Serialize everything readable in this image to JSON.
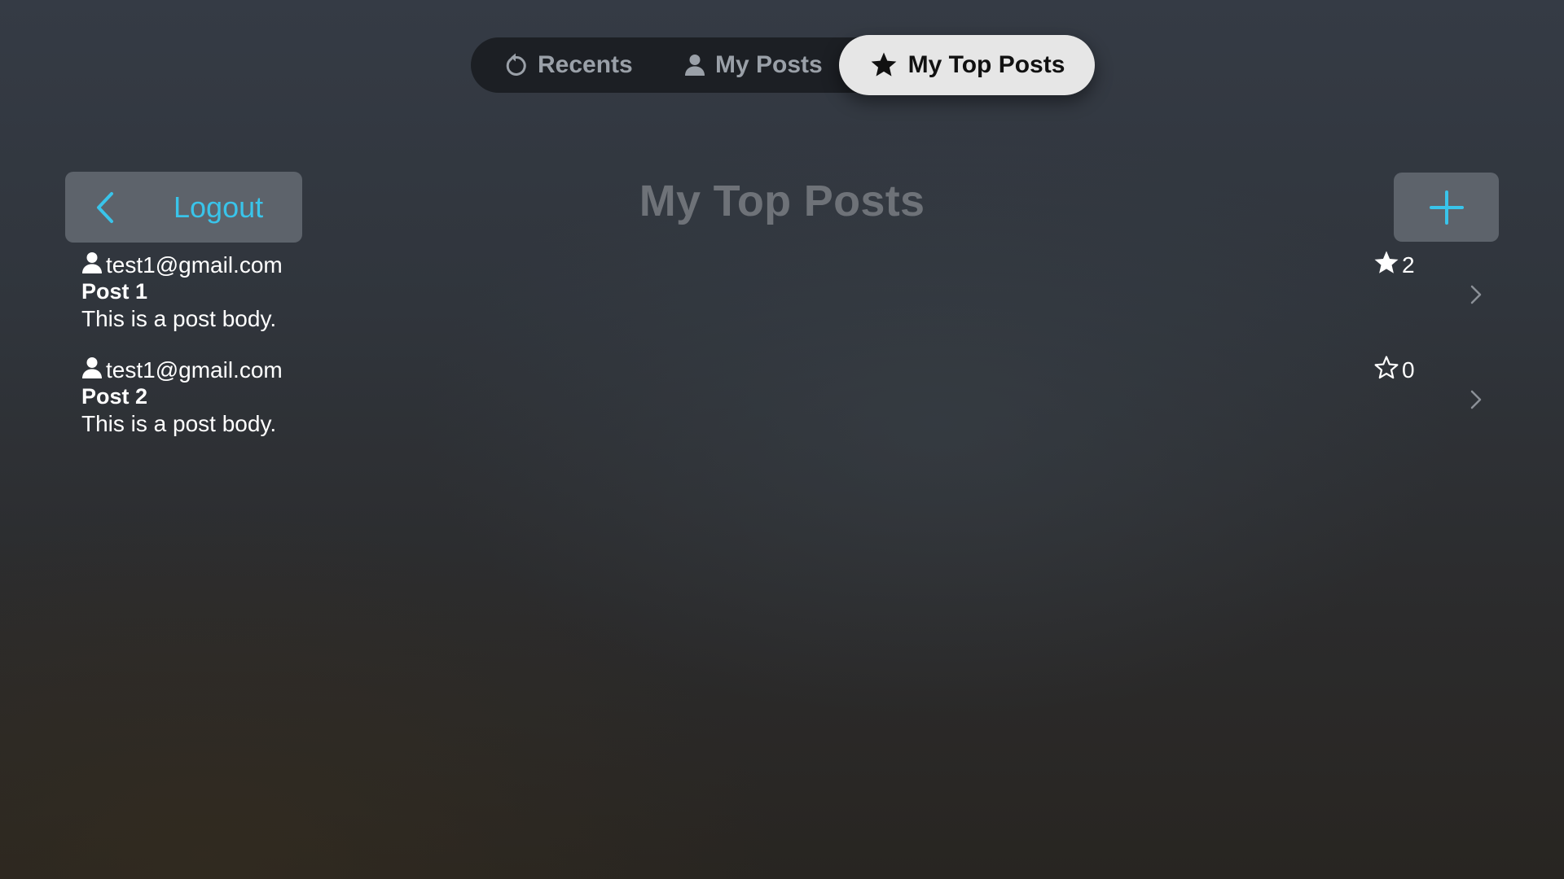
{
  "tabs": [
    {
      "label": "Recents",
      "icon": "recents-icon",
      "selected": false
    },
    {
      "label": "My Posts",
      "icon": "person-icon",
      "selected": false
    },
    {
      "label": "My Top Posts",
      "icon": "star-icon",
      "selected": true
    }
  ],
  "header": {
    "back_icon": "chevron-left-icon",
    "logout_label": "Logout",
    "title": "My Top Posts",
    "add_icon": "plus-icon"
  },
  "posts": [
    {
      "author": "test1@gmail.com",
      "title": "Post 1",
      "body": "This is a post body.",
      "star_count": "2",
      "starred": true
    },
    {
      "author": "test1@gmail.com",
      "title": "Post 2",
      "body": "This is a post body.",
      "star_count": "0",
      "starred": false
    }
  ],
  "colors": {
    "accent": "#39c4ea",
    "button_bg": "#5d636b",
    "tabbar_bg": "#1c1f24",
    "selected_tab_bg": "#e6e6e6",
    "title_text": "#6e7278"
  }
}
